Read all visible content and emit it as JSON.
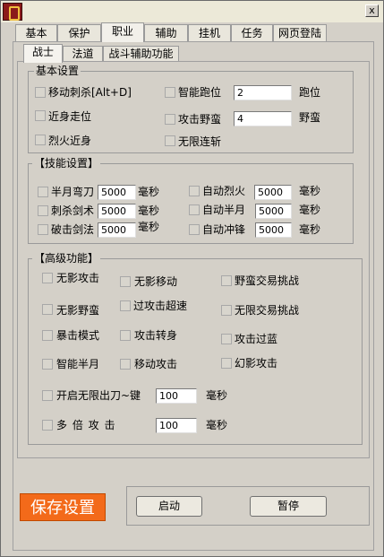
{
  "window": {
    "close_label": "x"
  },
  "tabs": [
    "基本",
    "保护",
    "职业",
    "辅助",
    "挂机",
    "任务",
    "网页登陆"
  ],
  "subtabs": [
    "战士",
    "法道",
    "战斗辅助功能"
  ],
  "basic": {
    "title": "基本设置",
    "move_stab": "移动刺杀[Alt+D]",
    "smart_run": "智能跑位",
    "smart_run_value": "2",
    "smart_run_unit": "跑位",
    "close_walk": "近身走位",
    "attack_savage": "攻击野蛮",
    "attack_savage_value": "4",
    "attack_savage_unit": "野蛮",
    "fire_close": "烈火近身",
    "infinite_slash": "无限连斩"
  },
  "skills": {
    "title": "【技能设置】",
    "half_moon": "半月弯刀",
    "half_moon_value": "5000",
    "stab_sword": "刺杀剑术",
    "stab_sword_value": "5000",
    "break_sword": "破击剑法",
    "break_sword_value": "5000",
    "auto_fire": "自动烈火",
    "auto_fire_value": "5000",
    "auto_half_moon": "自动半月",
    "auto_half_moon_value": "5000",
    "auto_charge": "自动冲锋",
    "auto_charge_value": "5000",
    "ms": "毫秒"
  },
  "advanced": {
    "title": "【高级功能】",
    "shadow_attack": "无影攻击",
    "shadow_move": "无影移动",
    "savage_trade": "野蛮交易挑战",
    "shadow_savage": "无影野蛮",
    "over_speed": "过攻击超速",
    "shadow_trade": "无限交易挑战",
    "crit_mode": "暴击模式",
    "attack_turn": "攻击转身",
    "attack_over_blue": "攻击过蓝",
    "smart_half_moon": "智能半月",
    "move_attack": "移动攻击",
    "phantom_attack": "幻影攻击",
    "infinite_blade": "开启无限出刀~键",
    "infinite_blade_value": "100",
    "multi_attack": "多 倍 攻 击",
    "multi_attack_value": "100",
    "ms": "毫秒"
  },
  "footer": {
    "save": "保存设置",
    "start": "启动",
    "pause": "暂停"
  }
}
